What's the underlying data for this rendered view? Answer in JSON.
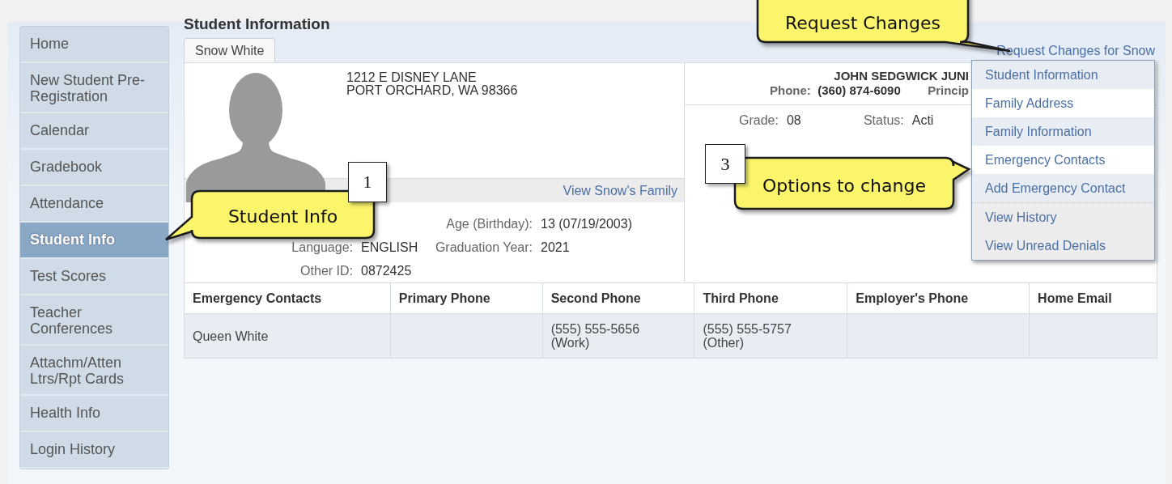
{
  "sidebar": {
    "items": [
      {
        "label": "Home",
        "selected": false
      },
      {
        "label": "New Student Pre-Registration",
        "selected": false
      },
      {
        "label": "Calendar",
        "selected": false
      },
      {
        "label": "Gradebook",
        "selected": false
      },
      {
        "label": "Attendance",
        "selected": false
      },
      {
        "label": "Student Info",
        "selected": true
      },
      {
        "label": "Test Scores",
        "selected": false
      },
      {
        "label": "Teacher Conferences",
        "selected": false
      },
      {
        "label": "Attachm/Atten Ltrs/Rpt Cards",
        "selected": false
      },
      {
        "label": "Health Info",
        "selected": false
      },
      {
        "label": "Login History",
        "selected": false
      }
    ]
  },
  "page_title": "Student Information",
  "tabs": [
    {
      "label": "Snow White",
      "selected": true
    }
  ],
  "request_link": "Request Changes for Snow",
  "request_menu": {
    "items": [
      {
        "label": "Student Information",
        "kind": "change"
      },
      {
        "label": "Family Address",
        "kind": "change"
      },
      {
        "label": "Family Information",
        "kind": "change"
      },
      {
        "label": "Emergency Contacts",
        "kind": "change"
      },
      {
        "label": "Add Emergency Contact",
        "kind": "change"
      },
      {
        "label": "View History",
        "kind": "view"
      },
      {
        "label": "View Unread Denials",
        "kind": "view"
      }
    ]
  },
  "student": {
    "address": [
      "1212 E DISNEY LANE",
      "PORT ORCHARD, WA 98366"
    ],
    "family_link": "View Snow's Family",
    "details_left": [
      {
        "label": "Language:",
        "value": "ENGLISH"
      },
      {
        "label": "Other ID:",
        "value": "0872425"
      }
    ],
    "details_right": [
      {
        "label": "Age (Birthday):",
        "value": "13 (07/19/2003)"
      },
      {
        "label": "Graduation Year:",
        "value": "2021"
      }
    ]
  },
  "school": {
    "name": "JOHN SEDGWICK JUNI",
    "phone_label": "Phone:",
    "phone": "(360) 874-6090",
    "principal_label": "Princip",
    "grade_label": "Grade:",
    "grade": "08",
    "status_label": "Status:",
    "status": "Acti"
  },
  "emergency_table": {
    "columns": [
      "Emergency Contacts",
      "Primary Phone",
      "Second Phone",
      "Third Phone",
      "Employer's Phone",
      "Home Email"
    ],
    "rows": [
      [
        "Queen White",
        "",
        "(555) 555-5656\n(Work)",
        "(555) 555-5757\n(Other)",
        "",
        ""
      ]
    ]
  },
  "callouts": [
    {
      "text": "Request Changes"
    },
    {
      "text": "Student Info",
      "number": "1"
    },
    {
      "text": "Options to change",
      "number": "3"
    }
  ]
}
